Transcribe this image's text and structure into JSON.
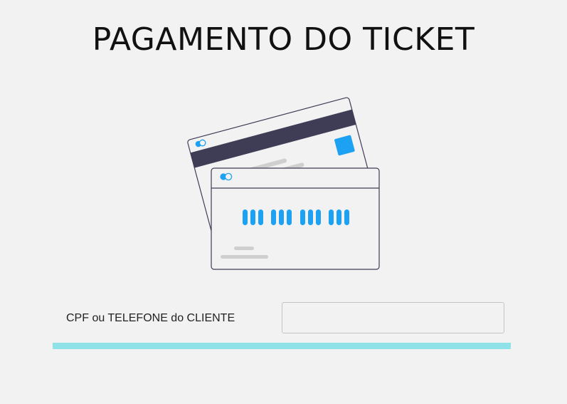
{
  "header": {
    "title": "PAGAMENTO DO TICKET"
  },
  "illustration": {
    "icon": "credit-cards-illustration",
    "colors": {
      "stripe": "#3f3d56",
      "accent": "#1da1f2",
      "placeholder": "#cfcfcf",
      "outline": "#3f3d56"
    }
  },
  "form": {
    "customer_label": "CPF ou TELEFONE do CLIENTE",
    "customer_value": "",
    "customer_placeholder": ""
  },
  "accent_bar": {
    "color": "#8fe3e8"
  }
}
